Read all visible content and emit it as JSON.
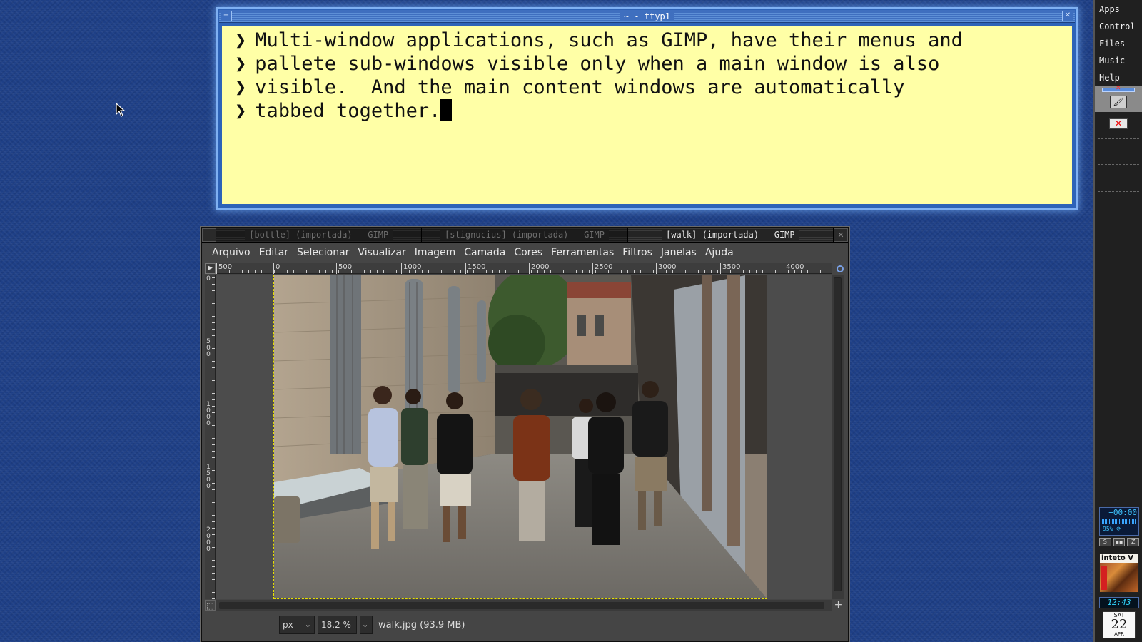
{
  "terminal": {
    "title": "~ - ttyp1",
    "lines": [
      {
        "prompt": "❯",
        "text": "Multi-window applications, such as GIMP, have their menus and"
      },
      {
        "prompt": "❯",
        "text": "pallete sub-windows visible only when a main window is also"
      },
      {
        "prompt": "❯",
        "text": "visible.  And the main content windows are automatically"
      },
      {
        "prompt": "❯",
        "text": "tabbed together."
      }
    ]
  },
  "gimp": {
    "tabs": [
      {
        "label": "[bottle] (importada) - GIMP",
        "active": false
      },
      {
        "label": "[stignucius] (importada) - GIMP",
        "active": false
      },
      {
        "label": "[walk] (importada) - GIMP",
        "active": true
      }
    ],
    "menu": [
      "Arquivo",
      "Editar",
      "Selecionar",
      "Visualizar",
      "Imagem",
      "Camada",
      "Cores",
      "Ferramentas",
      "Filtros",
      "Janelas",
      "Ajuda"
    ],
    "hruler_labels": [
      "500",
      "0",
      "500",
      "1000",
      "1500",
      "2000",
      "2500",
      "3000",
      "3500",
      "4000"
    ],
    "vruler_labels": [
      "0",
      "500",
      "1000",
      "1500",
      "2000"
    ],
    "status": {
      "unit": "px",
      "zoom": "18.2 %",
      "file": "walk.jpg (93.9 MB)"
    }
  },
  "panel": {
    "menu": [
      "Apps",
      "Control",
      "Files",
      "Music",
      "Help"
    ],
    "clock_offset": "+00:00",
    "cpu": "95% ⟳",
    "mini_buttons": [
      "S",
      "▪▪",
      "Z"
    ],
    "album_title": "inteto V",
    "time": "12:43",
    "calendar": {
      "dow": "SAT",
      "day": "22",
      "month": "APR"
    }
  },
  "colors": {
    "desktop": "#1e3f86",
    "terminal_bg": "#ffffa6",
    "terminal_frame": "#2d63b8",
    "gimp_bg": "#454545",
    "selection_border": "#e8e000"
  }
}
